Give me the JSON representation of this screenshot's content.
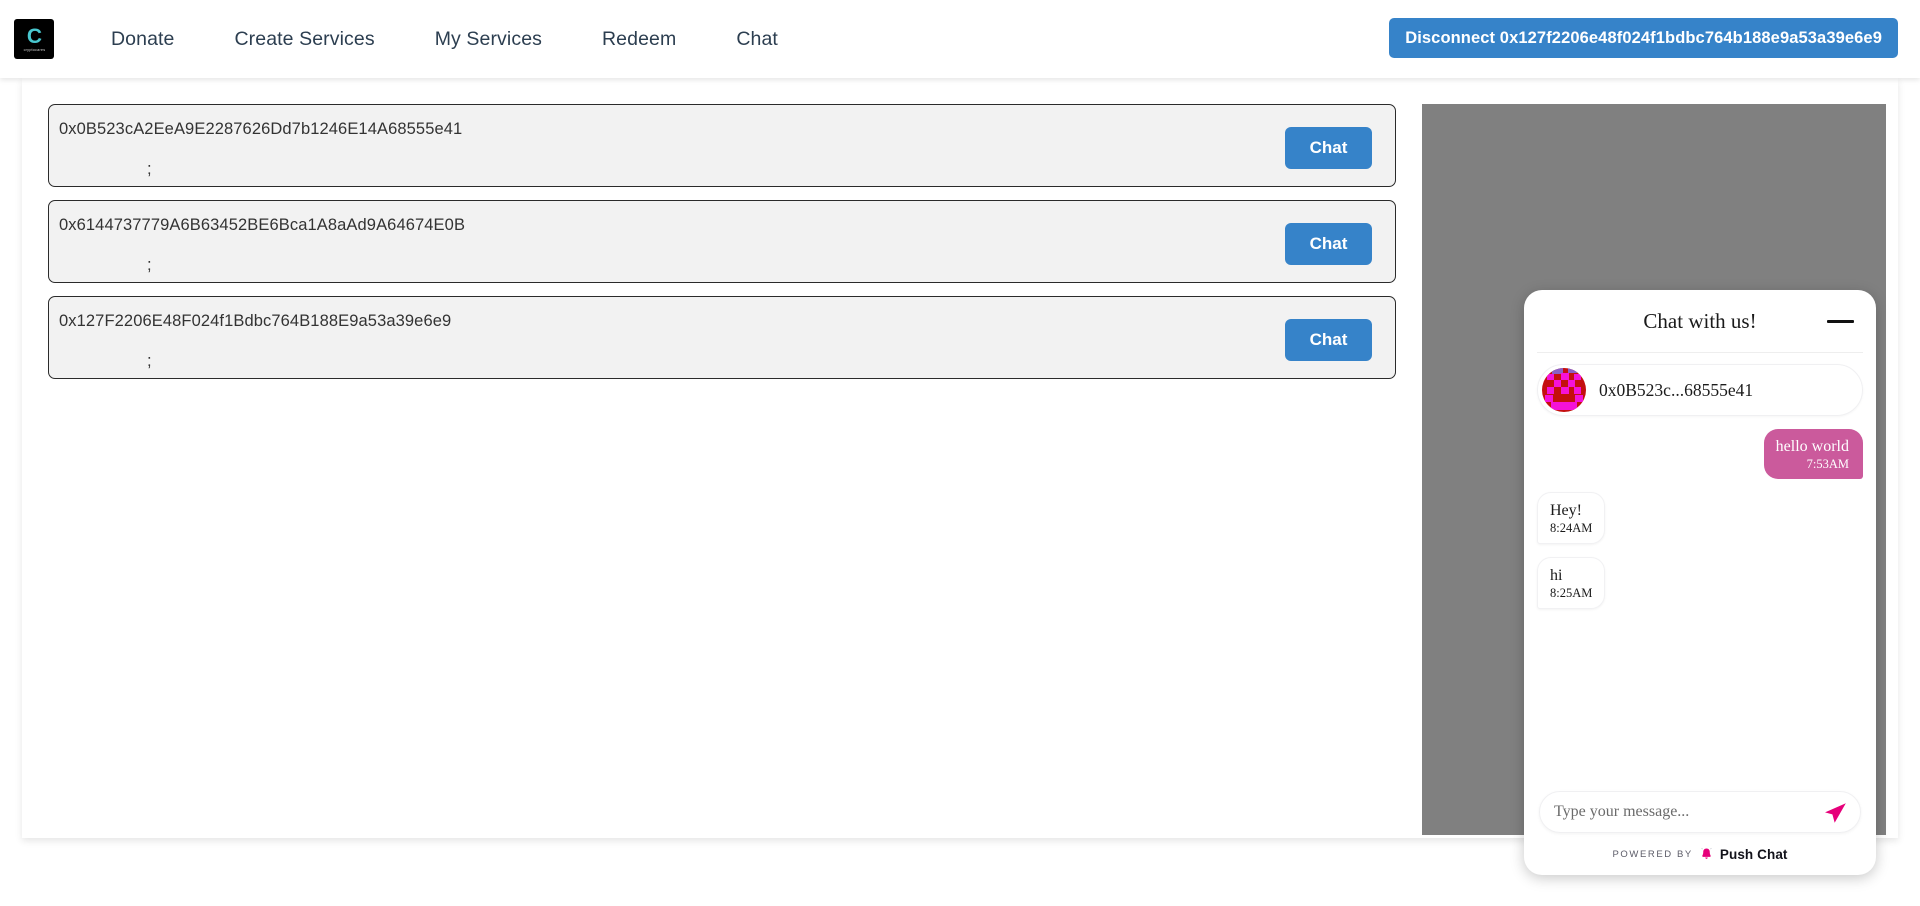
{
  "navbar": {
    "brand": {
      "mark": "C",
      "sub": "cryptocares",
      "icon": "brand-logo-icon"
    },
    "links": [
      {
        "label": "Donate"
      },
      {
        "label": "Create Services"
      },
      {
        "label": "My Services"
      },
      {
        "label": "Redeem"
      },
      {
        "label": "Chat"
      }
    ],
    "disconnect_label": "Disconnect 0x127f2206e48f024f1bdbc764b188e9a53a39e6e9"
  },
  "main": {
    "rows": [
      {
        "address": "0x0B523cA2EeA9E2287626Dd7b1246E14A68555e41",
        "note": ";",
        "button_label": "Chat"
      },
      {
        "address": "0x6144737779A6B63452BE6Bca1A8aAd9A64674E0B",
        "note": ";",
        "button_label": "Chat"
      },
      {
        "address": "0x127F2206E48F024f1Bdbc764B188E9a53a39e6e9",
        "note": ";",
        "button_label": "Chat"
      }
    ]
  },
  "chat_widget": {
    "title": "Chat with us!",
    "minimize_icon": "minimize-icon",
    "contact": {
      "name": "0x0B523c...68555e41",
      "avatar_icon": "blockies-avatar-icon"
    },
    "messages": [
      {
        "text": "hello world",
        "time": "7:53AM",
        "direction": "out"
      },
      {
        "text": "Hey!",
        "time": "8:24AM",
        "direction": "in"
      },
      {
        "text": "hi",
        "time": "8:25AM",
        "direction": "in"
      }
    ],
    "input_placeholder": "Type your message...",
    "input_value": "",
    "send_icon": "send-icon",
    "footer": {
      "powered_by": "POWERED BY",
      "brand": "Push Chat",
      "bell_icon": "bell-icon"
    }
  },
  "colors": {
    "accent_blue": "#3683c9",
    "chat_pink": "#cb5a9c",
    "push_magenta": "#e6007a",
    "overlay_gray": "#808080",
    "brand_cyan": "#49c7cf"
  }
}
